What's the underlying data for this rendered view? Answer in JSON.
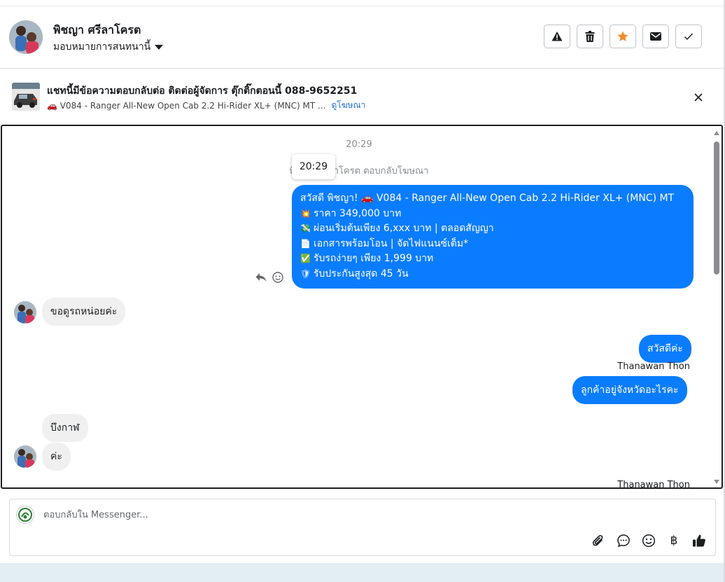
{
  "header": {
    "contact_name": "พิชญา ศรีลาโครต",
    "assign_label": "มอบหมายการสนทนานี้",
    "actions": [
      "warning-icon",
      "trash-icon",
      "star-icon",
      "envelope-icon",
      "check-icon"
    ],
    "star_color": "#f28c28"
  },
  "ad_banner": {
    "title": "แชทนี้มีข้อความตอบกลับต่อ ติดต่อผู้จัดการ ตุ๊กติ๊กตอนนี้ 088-9652251",
    "car_emoji": "🚗",
    "subtitle": "V084 - Ranger All-New Open Cab 2.2 Hi-Rider XL+ (MNC) MT ...",
    "link": "ดูโฆษณา"
  },
  "chat": {
    "timestamp": "20:29",
    "tooltip_time": "20:29",
    "system_note": "พิชญา ศรีลาโครต ตอบกลับโฆษณา",
    "ad_message": [
      {
        "emoji": "",
        "text": "สวัสดี พิชญา! 🚗 V084 - Ranger All-New Open Cab 2.2 Hi-Rider XL+ (MNC) MT"
      },
      {
        "emoji": "💥",
        "text": "ราคา 349,000 บาท"
      },
      {
        "emoji": "💸",
        "text": "ผ่อนเริ่มต้นเพียง 6,xxx บาท | ตลอดสัญญา"
      },
      {
        "emoji": "📄",
        "text": "เอกสารพร้อมโอน | จัดไฟแนนซ์เต็ม*"
      },
      {
        "emoji": "✅",
        "text": "รับรถง่ายๆ เพียง 1,999 บาท"
      },
      {
        "emoji": "🛡",
        "text": "รับประกันสูงสุด 45 วัน"
      }
    ],
    "incoming_1": "ขอดูรถหน่อยค่ะ",
    "outgoing_1": "สวัสดีค่ะ",
    "sender_1": "Thanawan Thon",
    "outgoing_2": "ลูกค้าอยู่จังหวัดอะไรคะ",
    "incoming_2": "บึงกาฬ",
    "incoming_3": "ค่ะ",
    "sender_2": "Thanawan Thon",
    "bubble_color": "#0a7cff"
  },
  "composer": {
    "placeholder": "ตอบกลับใน Messenger...",
    "tools": [
      "paperclip-icon",
      "chat-bubble-icon",
      "emoji-icon",
      "baht-icon",
      "thumbs-up-icon"
    ],
    "baht_symbol": "฿"
  }
}
